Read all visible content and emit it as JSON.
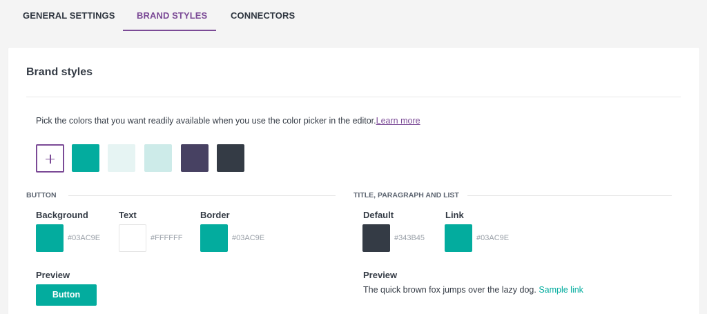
{
  "tabs": [
    {
      "label": "GENERAL SETTINGS",
      "active": false
    },
    {
      "label": "BRAND STYLES",
      "active": true
    },
    {
      "label": "CONNECTORS",
      "active": false
    }
  ],
  "card": {
    "title": "Brand styles",
    "description": "Pick the colors that you want readily available when you use the color picker in the editor.",
    "learn_more": "Learn more"
  },
  "palette": {
    "add_icon": "plus-icon",
    "swatches": [
      "#03AC9E",
      "#E6F4F3",
      "#CDEBE9",
      "#474162",
      "#343B45"
    ]
  },
  "button_section": {
    "heading": "BUTTON",
    "background": {
      "label": "Background",
      "hex": "#03AC9E"
    },
    "text": {
      "label": "Text",
      "hex": "#FFFFFF"
    },
    "border": {
      "label": "Border",
      "hex": "#03AC9E"
    },
    "preview_label": "Preview",
    "preview_button": "Button"
  },
  "text_section": {
    "heading": "TITLE, PARAGRAPH AND LIST",
    "default": {
      "label": "Default",
      "hex": "#343B45"
    },
    "link": {
      "label": "Link",
      "hex": "#03AC9E"
    },
    "preview_label": "Preview",
    "preview_text": "The quick brown fox jumps over the lazy dog.",
    "sample_link": "Sample link"
  },
  "colors": {
    "accent": "#7b4a96",
    "teal": "#03ac9e"
  }
}
